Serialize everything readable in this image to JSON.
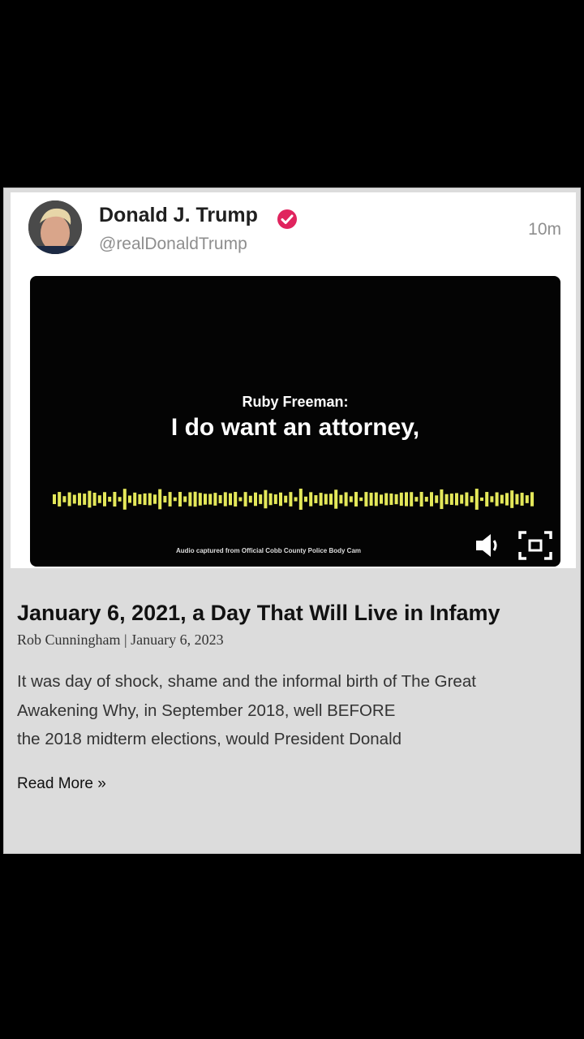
{
  "post": {
    "author_name": "Donald J. Trump",
    "handle": "@realDonaldTrump",
    "time_ago": "10m",
    "verified_color": "#e0245e"
  },
  "video": {
    "speaker_label": "Ruby Freeman:",
    "caption": "I do want an attorney,",
    "source_note": "Audio captured from Official Cobb County Police Body Cam",
    "waveform_color": "#e4e85a"
  },
  "article": {
    "title": "January 6, 2021, a Day That Will Live in Infamy",
    "byline": "Rob Cunningham | January 6, 2023",
    "excerpt_lines": [
      "It was day of shock, shame and the informal birth of The Great",
      "Awakening Why, in September 2018, well BEFORE",
      "the 2018 midterm elections, would President Donald"
    ],
    "read_more": "Read More »"
  }
}
